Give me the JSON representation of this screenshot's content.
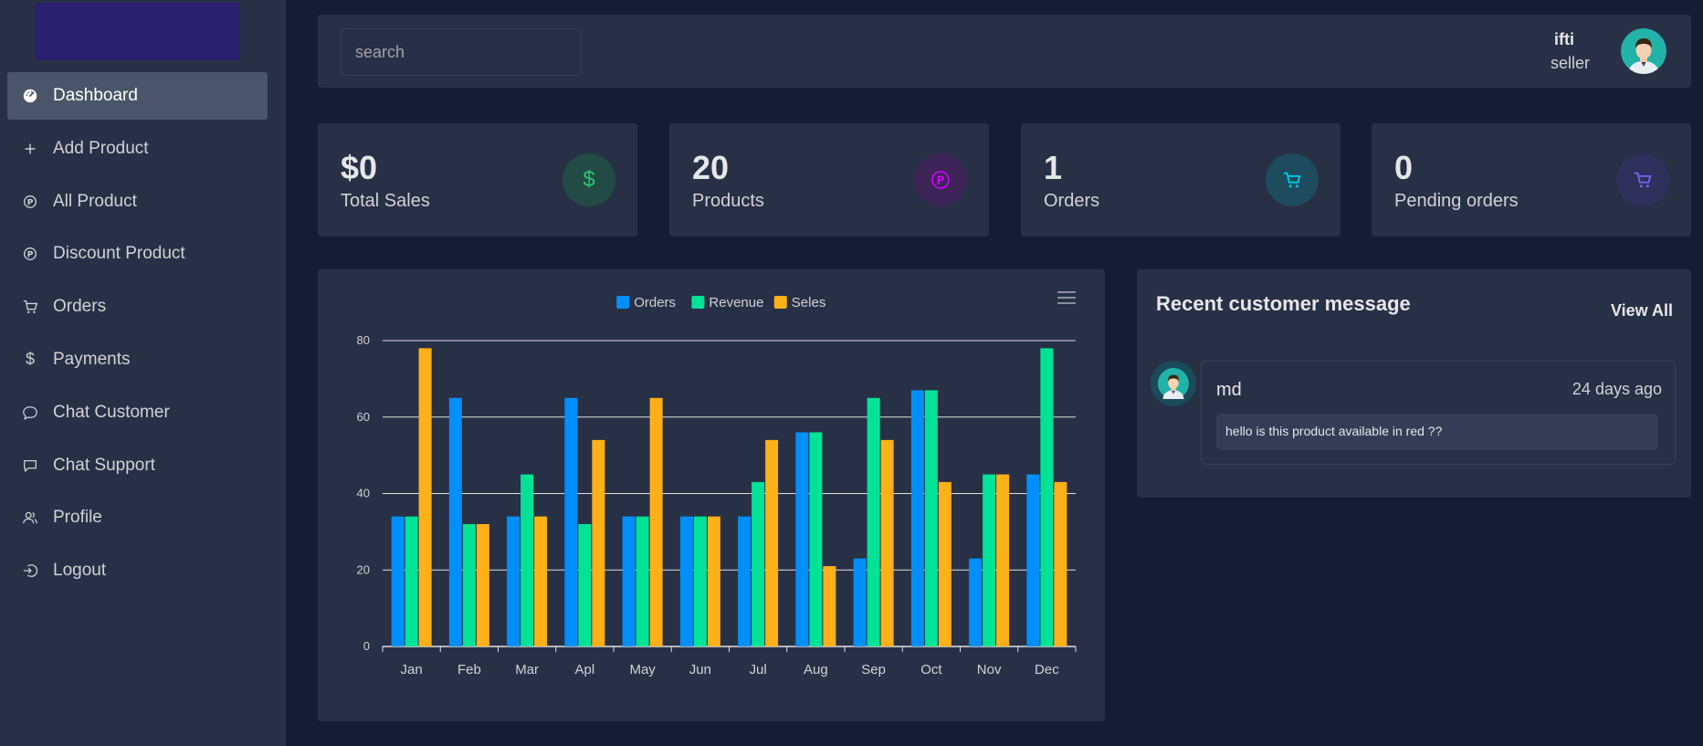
{
  "sidebar": {
    "items": [
      {
        "label": "Dashboard",
        "icon": "dashboard-icon",
        "active": true
      },
      {
        "label": "Add Product",
        "icon": "plus-icon"
      },
      {
        "label": "All Product",
        "icon": "product-icon"
      },
      {
        "label": "Discount Product",
        "icon": "product-icon"
      },
      {
        "label": "Orders",
        "icon": "cart-icon"
      },
      {
        "label": "Payments",
        "icon": "dollar-icon"
      },
      {
        "label": "Chat Customer",
        "icon": "chat-bubble-icon"
      },
      {
        "label": "Chat Support",
        "icon": "message-square-icon"
      },
      {
        "label": "Profile",
        "icon": "users-icon"
      },
      {
        "label": "Logout",
        "icon": "logout-icon"
      }
    ]
  },
  "header": {
    "search_placeholder": "search",
    "user_name": "ifti",
    "user_role": "seller"
  },
  "cards": [
    {
      "value": "$0",
      "label": "Total Sales",
      "icon": "dollar-icon",
      "color": "#28c76f",
      "bg": "#234b45"
    },
    {
      "value": "20",
      "label": "Products",
      "icon": "product-icon",
      "color": "#cd00ff",
      "bg": "#3d2557"
    },
    {
      "value": "1",
      "label": "Orders",
      "icon": "cart-icon",
      "color": "#00cfe8",
      "bg": "#1e4c5e"
    },
    {
      "value": "0",
      "label": "Pending orders",
      "icon": "cart-icon",
      "color": "#7367f0",
      "bg": "#2f315c"
    }
  ],
  "messages": {
    "title": "Recent customer message",
    "view_all": "View All",
    "items": [
      {
        "sender": "md",
        "time": "24 days ago",
        "text": "hello is this product available in red ??"
      }
    ]
  },
  "chart_data": {
    "type": "bar",
    "categories": [
      "Jan",
      "Feb",
      "Mar",
      "Apl",
      "May",
      "Jun",
      "Jul",
      "Aug",
      "Sep",
      "Oct",
      "Nov",
      "Dec"
    ],
    "series": [
      {
        "name": "Orders",
        "color": "#008ffb",
        "values": [
          34,
          65,
          34,
          65,
          34,
          34,
          34,
          56,
          23,
          67,
          23,
          45
        ]
      },
      {
        "name": "Revenue",
        "color": "#00e396",
        "values": [
          34,
          32,
          45,
          32,
          34,
          34,
          43,
          56,
          65,
          67,
          45,
          78
        ]
      },
      {
        "name": "Seles",
        "color": "#feb019",
        "values": [
          78,
          32,
          34,
          54,
          65,
          34,
          54,
          21,
          54,
          43,
          45,
          43
        ]
      }
    ],
    "ylim": [
      0,
      80
    ],
    "yticks": [
      0,
      20,
      40,
      60,
      80
    ],
    "grid": true,
    "legend": "top-center"
  }
}
